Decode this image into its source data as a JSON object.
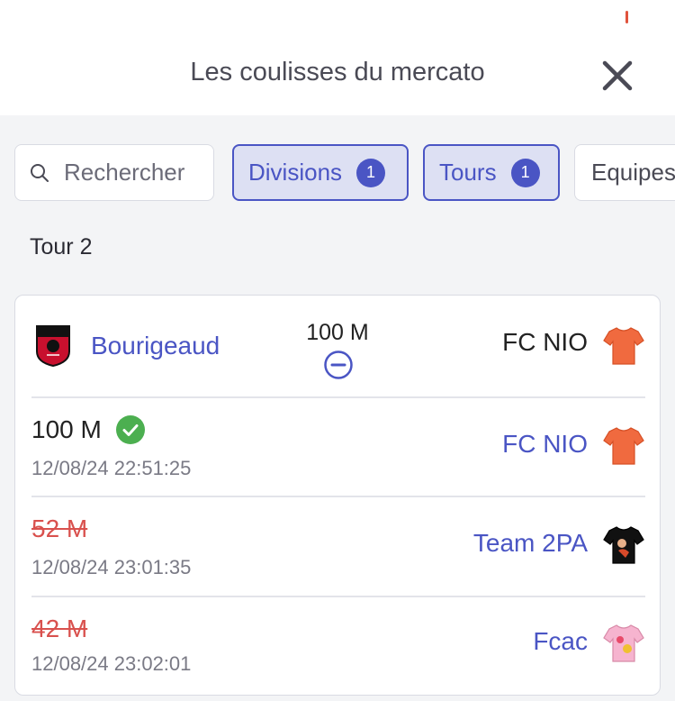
{
  "header": {
    "title": "Les coulisses du mercato",
    "close_icon": "close-icon"
  },
  "filters": {
    "search_placeholder": "Rechercher",
    "divisions_label": "Divisions",
    "divisions_count": "1",
    "tours_label": "Tours",
    "tours_count": "1",
    "equipes_label": "Equipes"
  },
  "section": {
    "title": "Tour 2"
  },
  "transfer": {
    "player_name": "Bourigeaud",
    "price": "100 M",
    "team": "FC NIO",
    "club_colors": {
      "primary": "#c8102e",
      "secondary": "#111111"
    },
    "bids": [
      {
        "amount": "100 M",
        "time": "12/08/24 22:51:25",
        "team": "FC NIO",
        "winning": true,
        "jersey_color": "#f06a3f"
      },
      {
        "amount": "52 M",
        "time": "12/08/24 23:01:35",
        "team": "Team 2PA",
        "winning": false,
        "jersey_color": "#111111"
      },
      {
        "amount": "42 M",
        "time": "12/08/24 23:02:01",
        "team": "Fcac",
        "winning": false,
        "jersey_color": "#f6b4cf"
      }
    ]
  },
  "colors": {
    "accent": "#4a55c4",
    "success": "#4caf50",
    "lost": "#d9514e"
  }
}
